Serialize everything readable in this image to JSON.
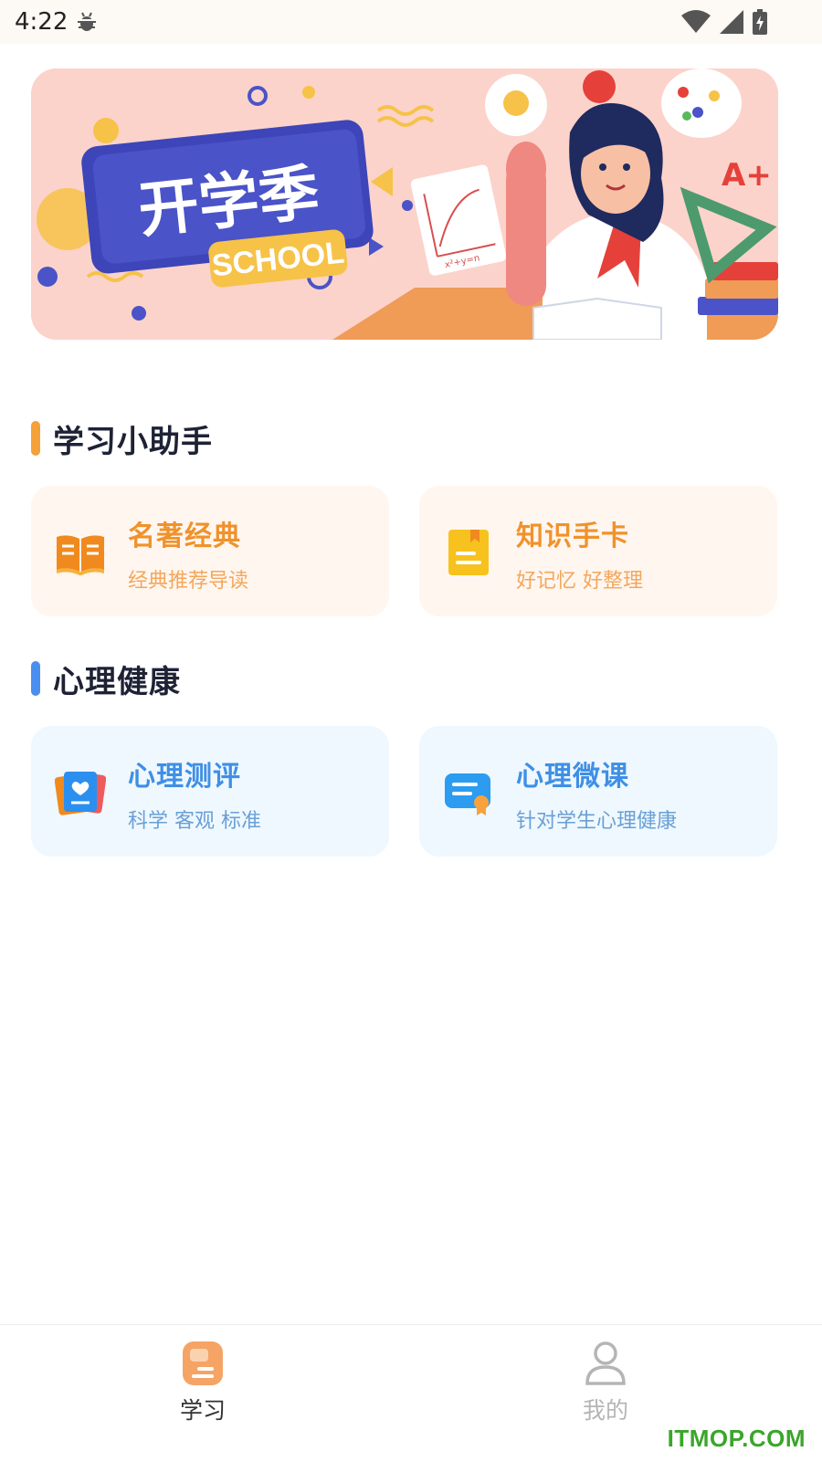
{
  "status_bar": {
    "time": "4:22"
  },
  "banner": {
    "headline": "开学季",
    "tag": "SCHOOL",
    "formula": "x²+y=n",
    "grade": "A+"
  },
  "sections": [
    {
      "title": "学习小助手",
      "accent": "#f5a13a",
      "cards": [
        {
          "title": "名著经典",
          "subtitle": "经典推荐导读",
          "icon": "open-book-icon"
        },
        {
          "title": "知识手卡",
          "subtitle": "好记忆 好整理",
          "icon": "note-card-icon"
        }
      ]
    },
    {
      "title": "心理健康",
      "accent": "#4a8ff0",
      "cards": [
        {
          "title": "心理测评",
          "subtitle": "科学 客观 标准",
          "icon": "assessment-cards-icon"
        },
        {
          "title": "心理微课",
          "subtitle": "针对学生心理健康",
          "icon": "micro-course-icon"
        }
      ]
    }
  ],
  "tabs": [
    {
      "label": "学习",
      "icon": "study-tab-icon",
      "active": true,
      "color": "#333333"
    },
    {
      "label": "我的",
      "icon": "profile-icon",
      "active": false,
      "color": "#b5b5b5"
    }
  ],
  "watermark": "ITMOP.COM"
}
